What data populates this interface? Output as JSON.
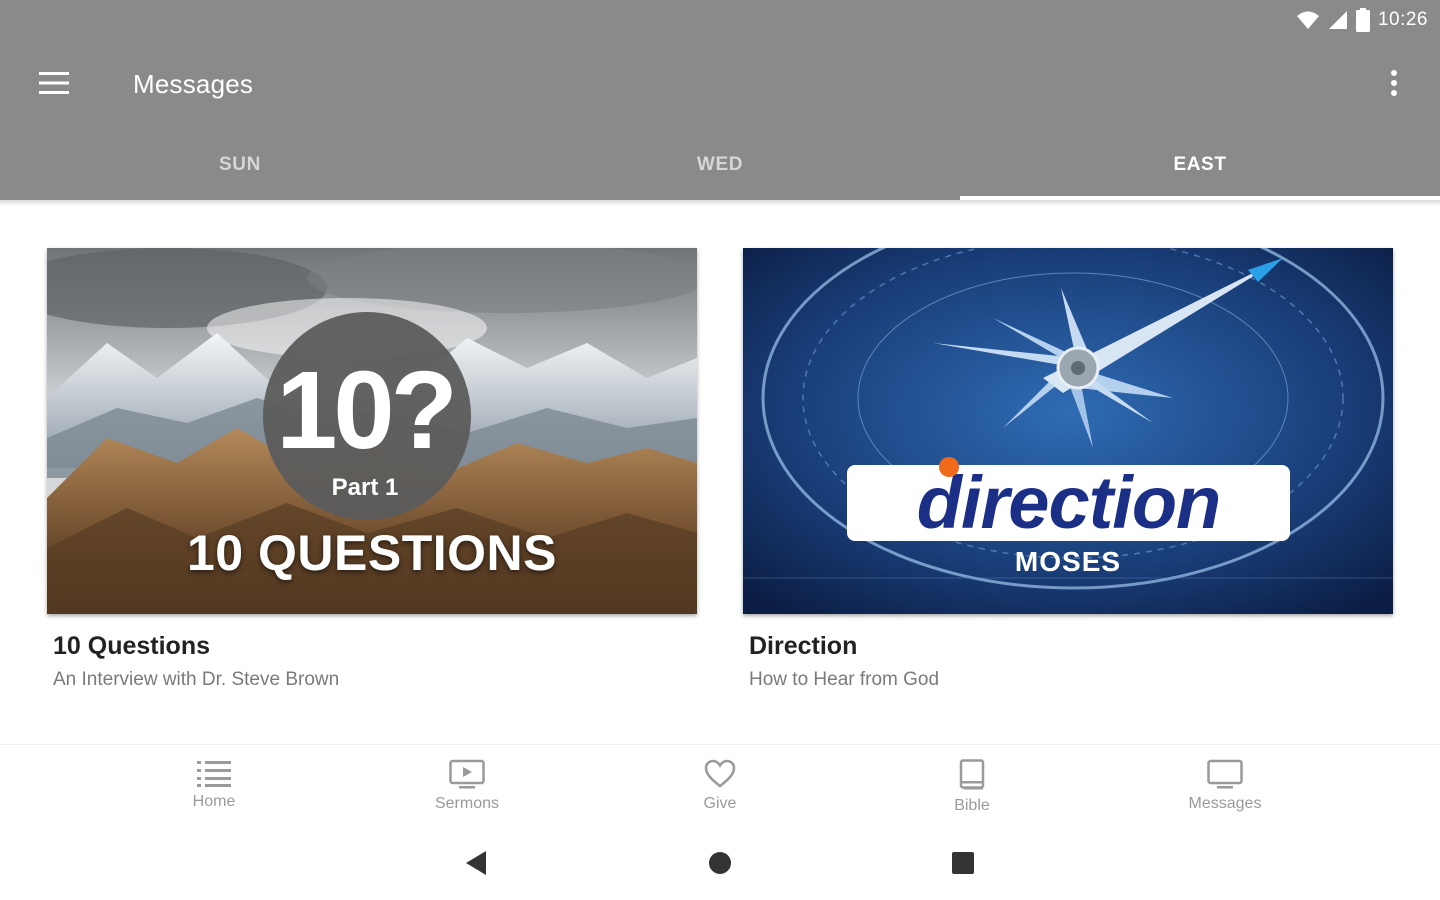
{
  "status_bar": {
    "time": "10:26",
    "icons": [
      "wifi-icon",
      "cellular-signal-icon",
      "battery-icon"
    ]
  },
  "toolbar": {
    "title": "Messages",
    "menu_icon": "hamburger-menu-icon",
    "overflow_icon": "more-vertical-icon"
  },
  "tabs": [
    {
      "label": "SUN",
      "active": false
    },
    {
      "label": "WED",
      "active": false
    },
    {
      "label": "EAST",
      "active": true
    }
  ],
  "cards": [
    {
      "title": "10 Questions",
      "subtitle": "An Interview with Dr. Steve Brown",
      "thumbnail": {
        "badge_number": "10?",
        "badge_part": "Part 1",
        "series_text": "10 QUESTIONS"
      }
    },
    {
      "title": "Direction",
      "subtitle": "How to Hear from God",
      "thumbnail": {
        "logo_word": "direction",
        "sub_text": "MOSES"
      }
    }
  ],
  "bottom_nav": [
    {
      "label": "Home",
      "icon": "list-icon"
    },
    {
      "label": "Sermons",
      "icon": "play-screen-icon"
    },
    {
      "label": "Give",
      "icon": "heart-icon"
    },
    {
      "label": "Bible",
      "icon": "book-icon"
    },
    {
      "label": "Messages",
      "icon": "monitor-icon"
    }
  ],
  "system_nav": [
    "back-icon",
    "home-circle-icon",
    "recents-square-icon"
  ],
  "colors": {
    "app_bar": "#8a8a8a",
    "tab_active": "#ffffff",
    "tab_inactive": "#d6d6d6",
    "title_text": "#222222",
    "subtitle_text": "#7a7a7a",
    "nav_icon": "#9a9a9a",
    "direction_blue": "#1b2f86",
    "direction_dot": "#f06a1c"
  }
}
